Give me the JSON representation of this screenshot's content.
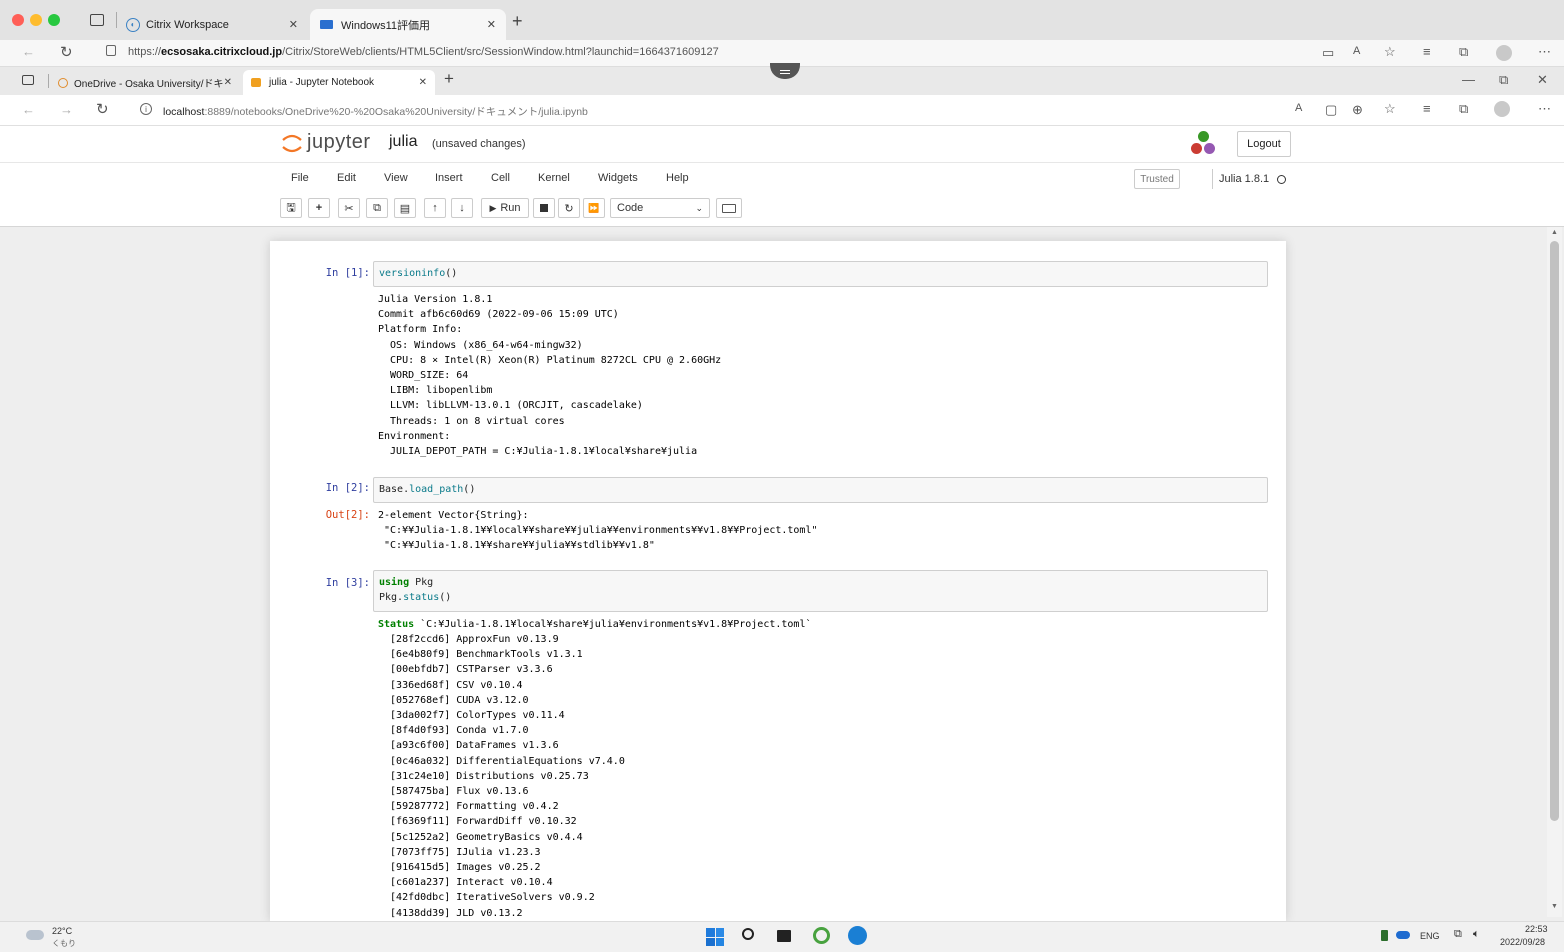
{
  "outer_browser": {
    "tabs": [
      {
        "label": "Citrix Workspace",
        "active": false
      },
      {
        "label": "Windows11評価用",
        "active": true
      }
    ],
    "new_tab": "+",
    "url_prefix": "https://",
    "url_domain": "ecsosaka.citrixcloud.jp",
    "url_rest": "/Citrix/StoreWeb/clients/HTML5Client/src/SessionWindow.html?launchid=1664371609127"
  },
  "inner_browser": {
    "tabs": [
      {
        "label": "OneDrive - Osaka University/ドキ",
        "active": false
      },
      {
        "label": "julia - Jupyter Notebook",
        "active": true
      }
    ],
    "url_host": "localhost",
    "url_rest": ":8889/notebooks/OneDrive%20-%20Osaka%20University/ドキュメント/julia.ipynb"
  },
  "jupyter": {
    "logo_text": "jupyter",
    "notebook_name": "julia",
    "save_status": "(unsaved changes)",
    "logout_label": "Logout",
    "menu": [
      "File",
      "Edit",
      "View",
      "Insert",
      "Cell",
      "Kernel",
      "Widgets",
      "Help"
    ],
    "trusted_label": "Trusted",
    "kernel_label": "Julia 1.8.1",
    "run_label": "Run",
    "cell_type": "Code"
  },
  "cells": {
    "c1_prompt": "In [1]:",
    "c1_code": "versioninfo",
    "c1_code_tail": "()",
    "c1_output": "Julia Version 1.8.1\nCommit afb6c60d69 (2022-09-06 15:09 UTC)\nPlatform Info:\n  OS: Windows (x86_64-w64-mingw32)\n  CPU: 8 × Intel(R) Xeon(R) Platinum 8272CL CPU @ 2.60GHz\n  WORD_SIZE: 64\n  LIBM: libopenlibm\n  LLVM: libLLVM-13.0.1 (ORCJIT, cascadelake)\n  Threads: 1 on 8 virtual cores\nEnvironment:\n  JULIA_DEPOT_PATH = C:¥Julia-1.8.1¥local¥share¥julia",
    "c2_prompt": "In [2]:",
    "c2_code_a": "Base.",
    "c2_code_b": "load_path",
    "c2_code_c": "()",
    "c2_out_prompt": "Out[2]:",
    "c2_output": "2-element Vector{String}:\n \"C:¥¥Julia-1.8.1¥¥local¥¥share¥¥julia¥¥environments¥¥v1.8¥¥Project.toml\"\n \"C:¥¥Julia-1.8.1¥¥share¥¥julia¥¥stdlib¥¥v1.8\"",
    "c3_prompt": "In [3]:",
    "c3_kw": "using",
    "c3_line1_rest": " Pkg",
    "c3_line2_a": "Pkg.",
    "c3_line2_b": "status",
    "c3_line2_c": "()",
    "c3_status_kw": "Status",
    "c3_status_rest": " `C:¥Julia-1.8.1¥local¥share¥julia¥environments¥v1.8¥Project.toml`",
    "c3_output": "  [28f2ccd6] ApproxFun v0.13.9\n  [6e4b80f9] BenchmarkTools v1.3.1\n  [00ebfdb7] CSTParser v3.3.6\n  [336ed68f] CSV v0.10.4\n  [052768ef] CUDA v3.12.0\n  [3da002f7] ColorTypes v0.11.4\n  [8f4d0f93] Conda v1.7.0\n  [a93c6f00] DataFrames v1.3.6\n  [0c46a032] DifferentialEquations v7.4.0\n  [31c24e10] Distributions v0.25.73\n  [587475ba] Flux v0.13.6\n  [59287772] Formatting v0.4.2\n  [f6369f11] ForwardDiff v0.10.32\n  [5c1252a2] GeometryBasics v0.4.4\n  [7073ff75] IJulia v1.23.3\n  [916415d5] Images v0.25.2\n  [c601a237] Interact v0.10.4\n  [42fd0dbc] IterativeSolvers v0.9.2\n  [4138dd39] JLD v0.13.2"
  },
  "taskbar": {
    "temp": "22°C",
    "weather": "くもり",
    "lang": "ENG",
    "time": "22:53",
    "date": "2022/09/28"
  }
}
